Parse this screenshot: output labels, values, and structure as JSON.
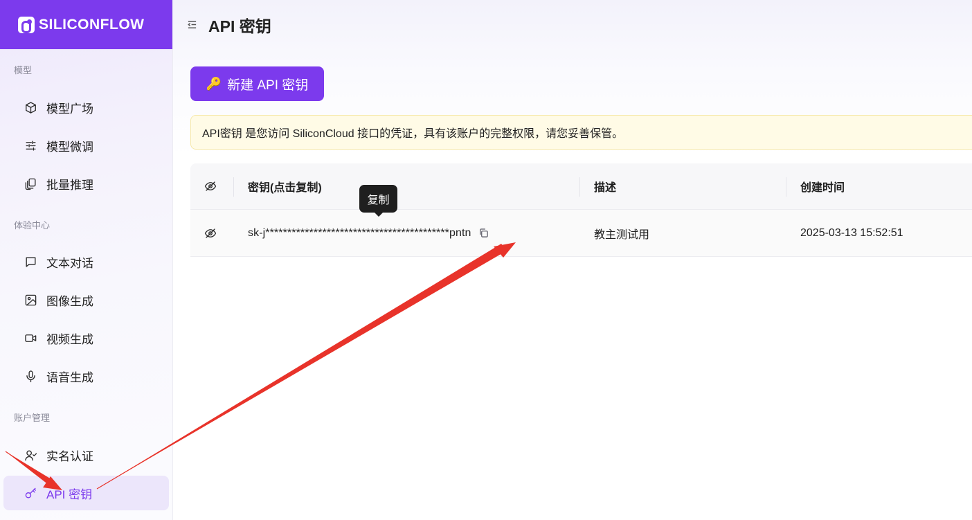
{
  "brand": {
    "name": "SILICONFLOW"
  },
  "header": {
    "title": "API 密钥"
  },
  "sidebar": {
    "sections": [
      {
        "label": "模型",
        "items": [
          {
            "label": "模型广场",
            "icon": "cube-icon"
          },
          {
            "label": "模型微调",
            "icon": "sliders-icon"
          },
          {
            "label": "批量推理",
            "icon": "copies-icon"
          }
        ]
      },
      {
        "label": "体验中心",
        "items": [
          {
            "label": "文本对话",
            "icon": "chat-icon"
          },
          {
            "label": "图像生成",
            "icon": "image-icon"
          },
          {
            "label": "视频生成",
            "icon": "video-icon"
          },
          {
            "label": "语音生成",
            "icon": "mic-icon"
          }
        ]
      },
      {
        "label": "账户管理",
        "items": [
          {
            "label": "实名认证",
            "icon": "user-check-icon"
          },
          {
            "label": "API 密钥",
            "icon": "key-icon",
            "active": true
          }
        ]
      }
    ]
  },
  "actions": {
    "new_key_label": "新建 API 密钥",
    "new_key_icon": "🔑"
  },
  "notice": {
    "text": "API密钥 是您访问 SiliconCloud 接口的凭证，具有该账户的完整权限，请您妥善保管。"
  },
  "table": {
    "columns": [
      "密钥(点击复制)",
      "描述",
      "创建时间"
    ],
    "rows": [
      {
        "key": "sk-j******************************************pntn",
        "description": "教主测试用",
        "created": "2025-03-13 15:52:51"
      }
    ]
  },
  "tooltip": {
    "text": "复制"
  },
  "colors": {
    "accent": "#7c3aed",
    "notice_bg": "#fffbe6",
    "annotation_arrow": "#e8332a"
  }
}
